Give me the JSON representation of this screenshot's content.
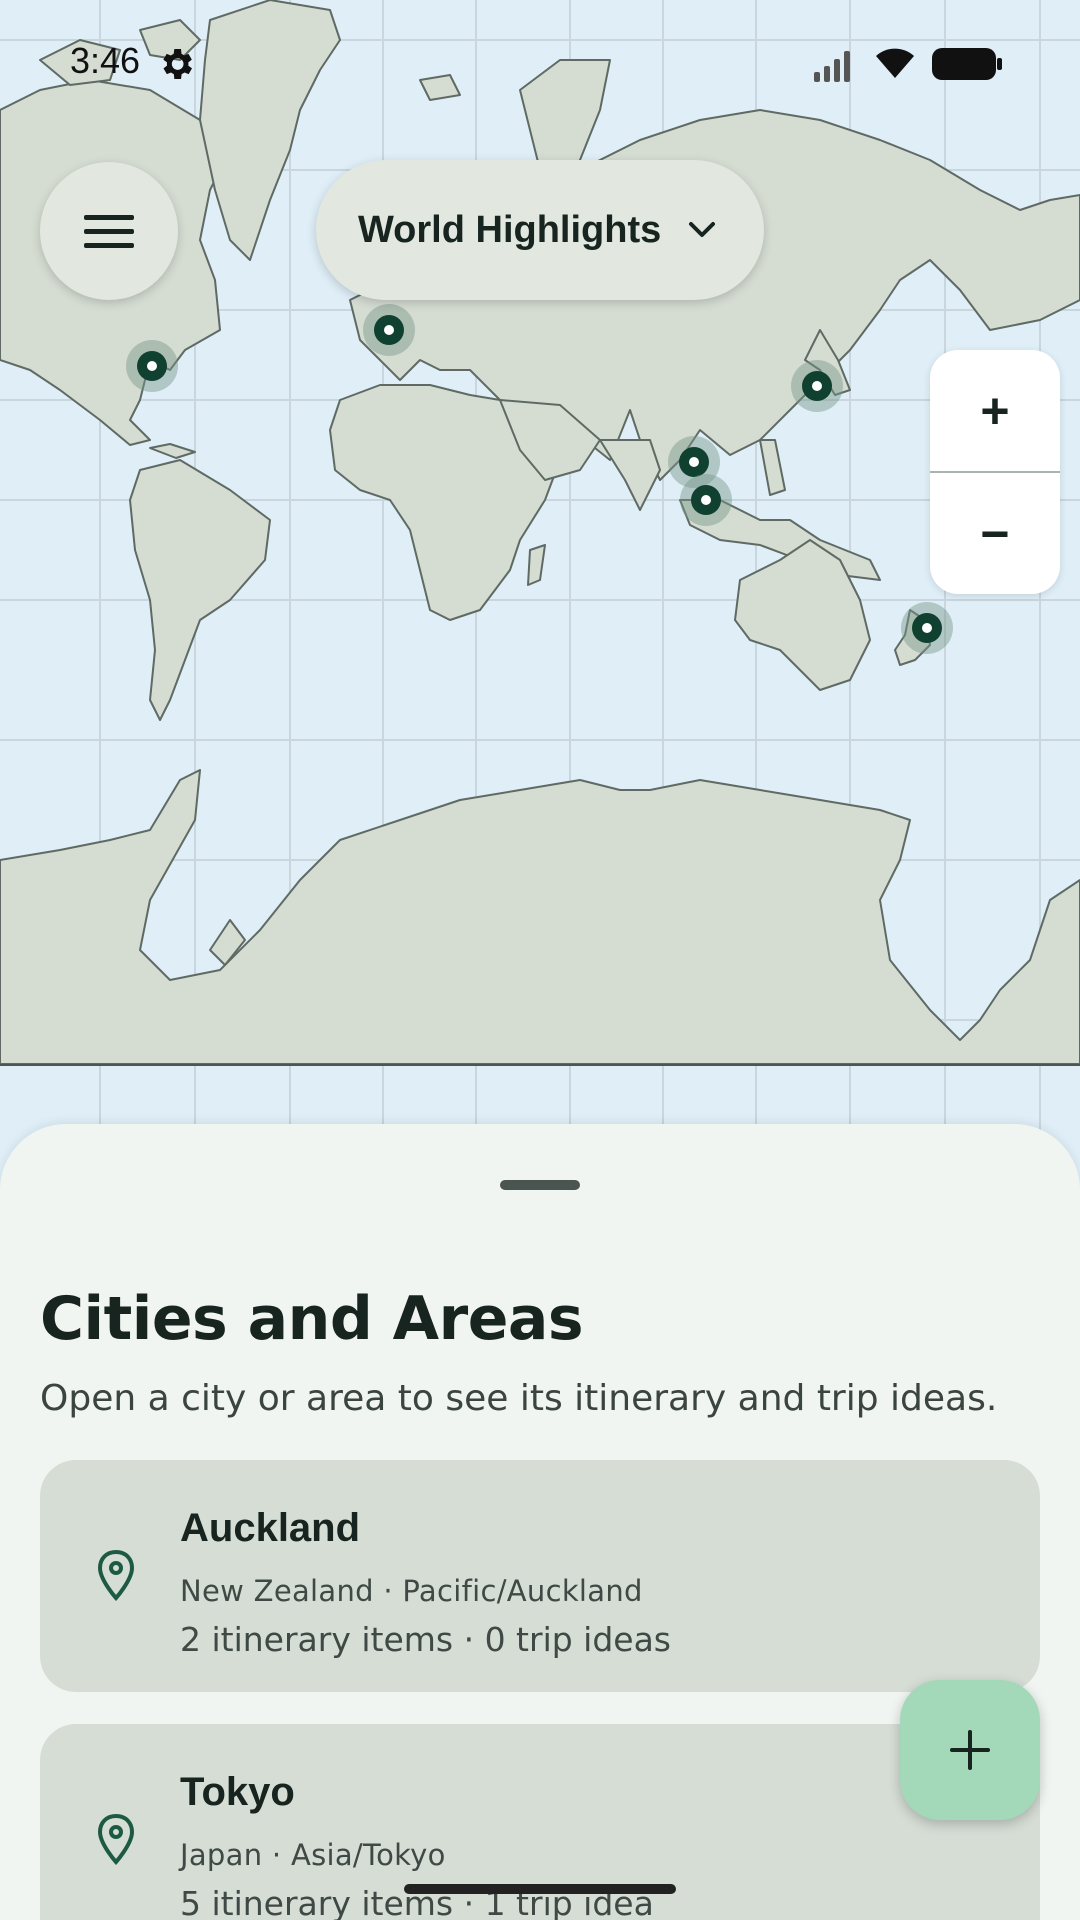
{
  "status_bar": {
    "time": "3:46"
  },
  "header": {
    "title": "World Highlights"
  },
  "zoom": {
    "in_label": "+",
    "out_label": "−"
  },
  "map_pins": [
    "pin-new-york",
    "pin-europe",
    "pin-tokyo",
    "pin-southeast-asia-north",
    "pin-southeast-asia-south",
    "pin-auckland"
  ],
  "sheet": {
    "title": "Cities and Areas",
    "subtitle": "Open a city or area to see its itinerary and trip ideas.",
    "cards": [
      {
        "city": "Auckland",
        "meta": "New Zealand · Pacific/Auckland",
        "counts": "2 itinerary items · 0 trip ideas"
      },
      {
        "city": "Tokyo",
        "meta": "Japan · Asia/Tokyo",
        "counts": "5 itinerary items · 1 trip idea"
      }
    ]
  },
  "colors": {
    "accent": "#10402f",
    "fab": "#a3d9b9",
    "land": "#d5ddd3",
    "water": "#dfeef7",
    "sheet": "#f1f5f1",
    "card": "#d5ddd5"
  },
  "icons": [
    "settings-gear-icon",
    "signal-icon",
    "wifi-icon",
    "battery-icon",
    "menu-icon",
    "chevron-down-icon",
    "location-pin-icon",
    "plus-icon"
  ]
}
